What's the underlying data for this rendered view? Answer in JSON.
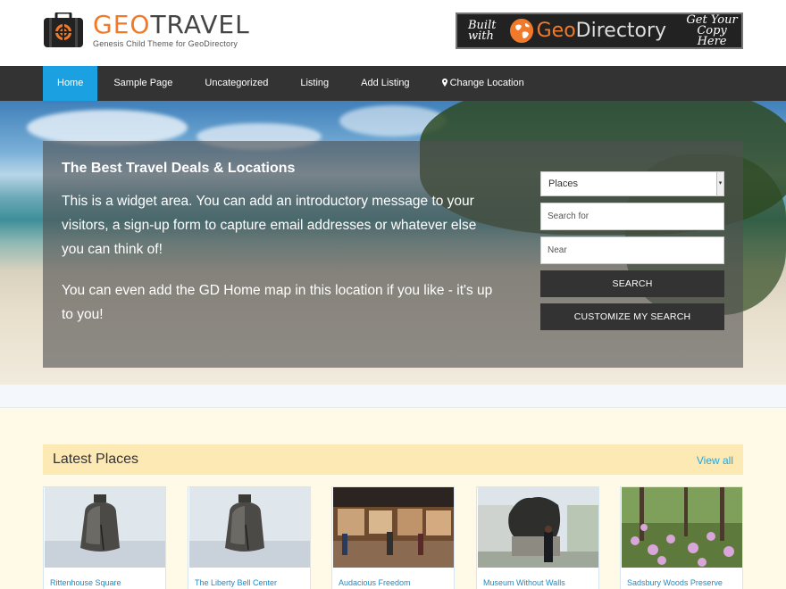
{
  "site": {
    "logo_geo": "GEO",
    "logo_travel": "TRAVEL",
    "tagline": "Genesis Child Theme for GeoDirectory"
  },
  "banner": {
    "built_line1": "Built",
    "built_line2": "with",
    "name_geo": "Geo",
    "name_directory": "Directory",
    "copy_line1": "Get Your",
    "copy_line2": "Copy Here"
  },
  "nav": {
    "items": [
      {
        "label": "Home",
        "active": true
      },
      {
        "label": "Sample Page"
      },
      {
        "label": "Uncategorized"
      },
      {
        "label": "Listing"
      },
      {
        "label": "Add Listing"
      },
      {
        "label": "Change Location",
        "icon": "map-marker-icon"
      }
    ]
  },
  "hero": {
    "title": "The Best Travel Deals & Locations",
    "paragraph1": "This is a widget area. You can add an introductory message to your visitors, a sign-up form to capture email addresses or whatever else you can think of!",
    "paragraph2": "You can even add the GD Home map in this location if you like - it's up to you!"
  },
  "search": {
    "select_value": "Places",
    "search_placeholder": "Search for",
    "near_placeholder": "Near",
    "search_button": "SEARCH",
    "customize_button": "CUSTOMIZE MY SEARCH"
  },
  "latest_places": {
    "title": "Latest Places",
    "view_all": "View all",
    "cards": [
      {
        "name": "Rittenhouse Square"
      },
      {
        "name": "The Liberty Bell Center"
      },
      {
        "name": "Audacious Freedom"
      },
      {
        "name": "Museum Without Walls"
      },
      {
        "name": "Sadsbury Woods Preserve"
      }
    ]
  },
  "colors": {
    "accent_blue": "#1ba1e2",
    "brand_orange": "#f07a2a",
    "nav_bg": "#333333",
    "link_blue": "#2ba3d5"
  }
}
